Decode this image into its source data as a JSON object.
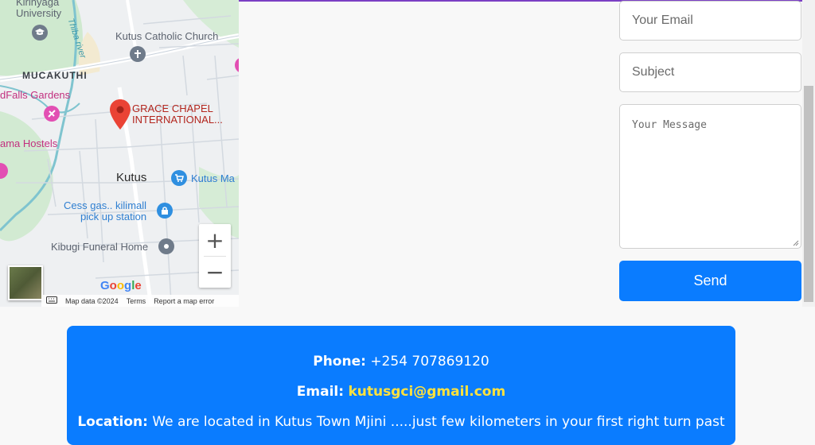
{
  "map": {
    "labels": {
      "kirinyaga_top": "Kirinyaga",
      "university": "University",
      "thiba_river": "Thiba river",
      "kutus_church": "Kutus Catholic Church",
      "mucakuthi": "MUCAKUTHI",
      "falls_gardens": "dFalls Gardens",
      "grace_chapel_1": "GRACE CHAPEL",
      "grace_chapel_2": "INTERNATIONAL...",
      "hostels": "ama Hostels",
      "kutus": "Kutus",
      "kutus_market": "Kutus Ma",
      "cess_gas_1": "Cess gas.. kilimall",
      "cess_gas_2": "pick up station",
      "funeral_home": "Kibugi Funeral Home"
    },
    "zoom_in": "+",
    "zoom_out": "−",
    "google": [
      "G",
      "o",
      "o",
      "g",
      "l",
      "e"
    ],
    "google_colors": [
      "#4285F4",
      "#EA4335",
      "#FBBC05",
      "#4285F4",
      "#34A853",
      "#EA4335"
    ],
    "attribution": {
      "map_data": "Map data ©2024",
      "terms": "Terms",
      "report": "Report a map error"
    }
  },
  "form": {
    "email_placeholder": "Your Email",
    "subject_placeholder": "Subject",
    "message_placeholder": "Your Message",
    "send_label": "Send"
  },
  "contact": {
    "phone_label": "Phone:",
    "phone_value": "+254 707869120",
    "email_label": "Email:",
    "email_value": "kutusgci@gmail.com",
    "location_label": "Location:",
    "location_value": "We are located in Kutus Town Mjini .....just few kilometers in your first right turn past"
  },
  "colors": {
    "accent": "#0a7cff",
    "email_link": "#ffe23d",
    "top_border": "#7b3fc4"
  }
}
